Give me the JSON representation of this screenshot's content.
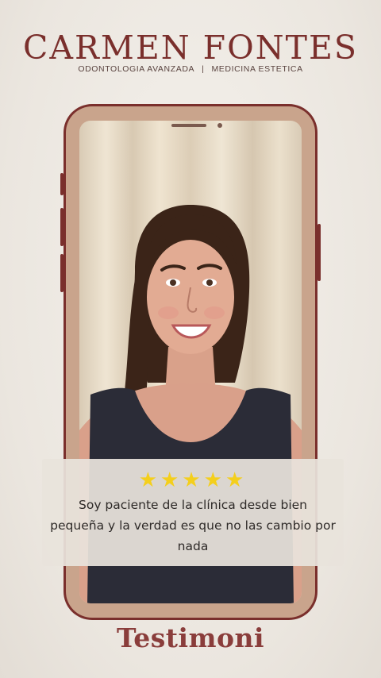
{
  "brand": {
    "name": "CARMEN FONTES",
    "subtitle_left": "ODONTOLOGIA AVANZADA",
    "subtitle_sep": "|",
    "subtitle_right": "MEDICINA ESTETICA"
  },
  "review": {
    "rating": 5,
    "stars": "★★★★★",
    "quote": "Soy paciente de la clínica desde bien pequeña y la verdad es que no las cambio por nada"
  },
  "footer": {
    "title": "Testimoni"
  },
  "colors": {
    "brand": "#7a2f2c",
    "star": "#f4cf1c",
    "frame": "#c9a48c"
  },
  "icons": {
    "rating": "star-icon"
  }
}
